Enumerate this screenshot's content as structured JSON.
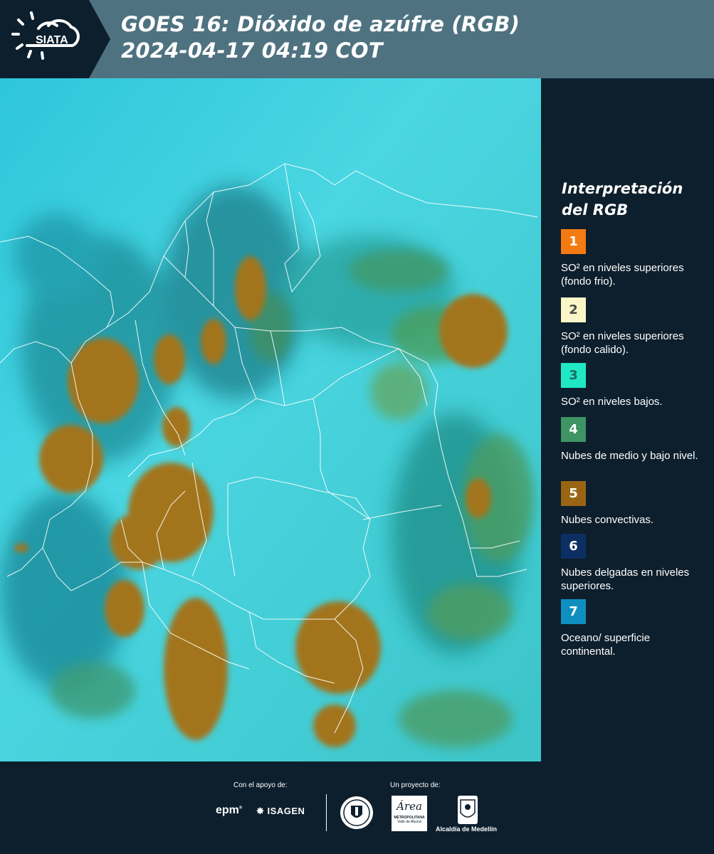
{
  "header": {
    "brand": "SIATA",
    "title_line1": "GOES 16: Dióxido de azúfre (RGB)",
    "title_line2": " 2024-04-17 04:19 COT"
  },
  "legend": {
    "title_line1": "Interpretación",
    "title_line2": "del RGB",
    "items": [
      {
        "number": "1",
        "color": "#f47b12",
        "text_color": "#ffffff",
        "label": "SO² en niveles superiores (fondo frio)."
      },
      {
        "number": "2",
        "color": "#fbf6c7",
        "text_color": "#4a4a4a",
        "label": "SO² en niveles superiores (fondo calido)."
      },
      {
        "number": "3",
        "color": "#20e8c4",
        "text_color": "#1e6b60",
        "label": "SO² en niveles bajos."
      },
      {
        "number": "4",
        "color": "#3e9463",
        "text_color": "#ffffff",
        "label": "Nubes de medio y bajo nivel."
      },
      {
        "number": "5",
        "color": "#9a6513",
        "text_color": "#ffffff",
        "label": "Nubes convectivas."
      },
      {
        "number": "6",
        "color": "#0c2f63",
        "text_color": "#ffffff",
        "label": "Nubes delgadas en niveles superiores."
      },
      {
        "number": "7",
        "color": "#0f8fc0",
        "text_color": "#ffffff",
        "label": "Oceano/ superficie continental."
      }
    ]
  },
  "footer": {
    "support_label": "Con el apoyo de:",
    "project_label": "Un proyecto de:",
    "logo_epm": "epm",
    "logo_isagen": "ISAGEN",
    "logo_area_line1": "Área",
    "logo_area_line2": "METROPOLITANA",
    "logo_area_line3": "Valle de Aburrá",
    "logo_alcaldia": "Alcaldía de Medellín"
  }
}
